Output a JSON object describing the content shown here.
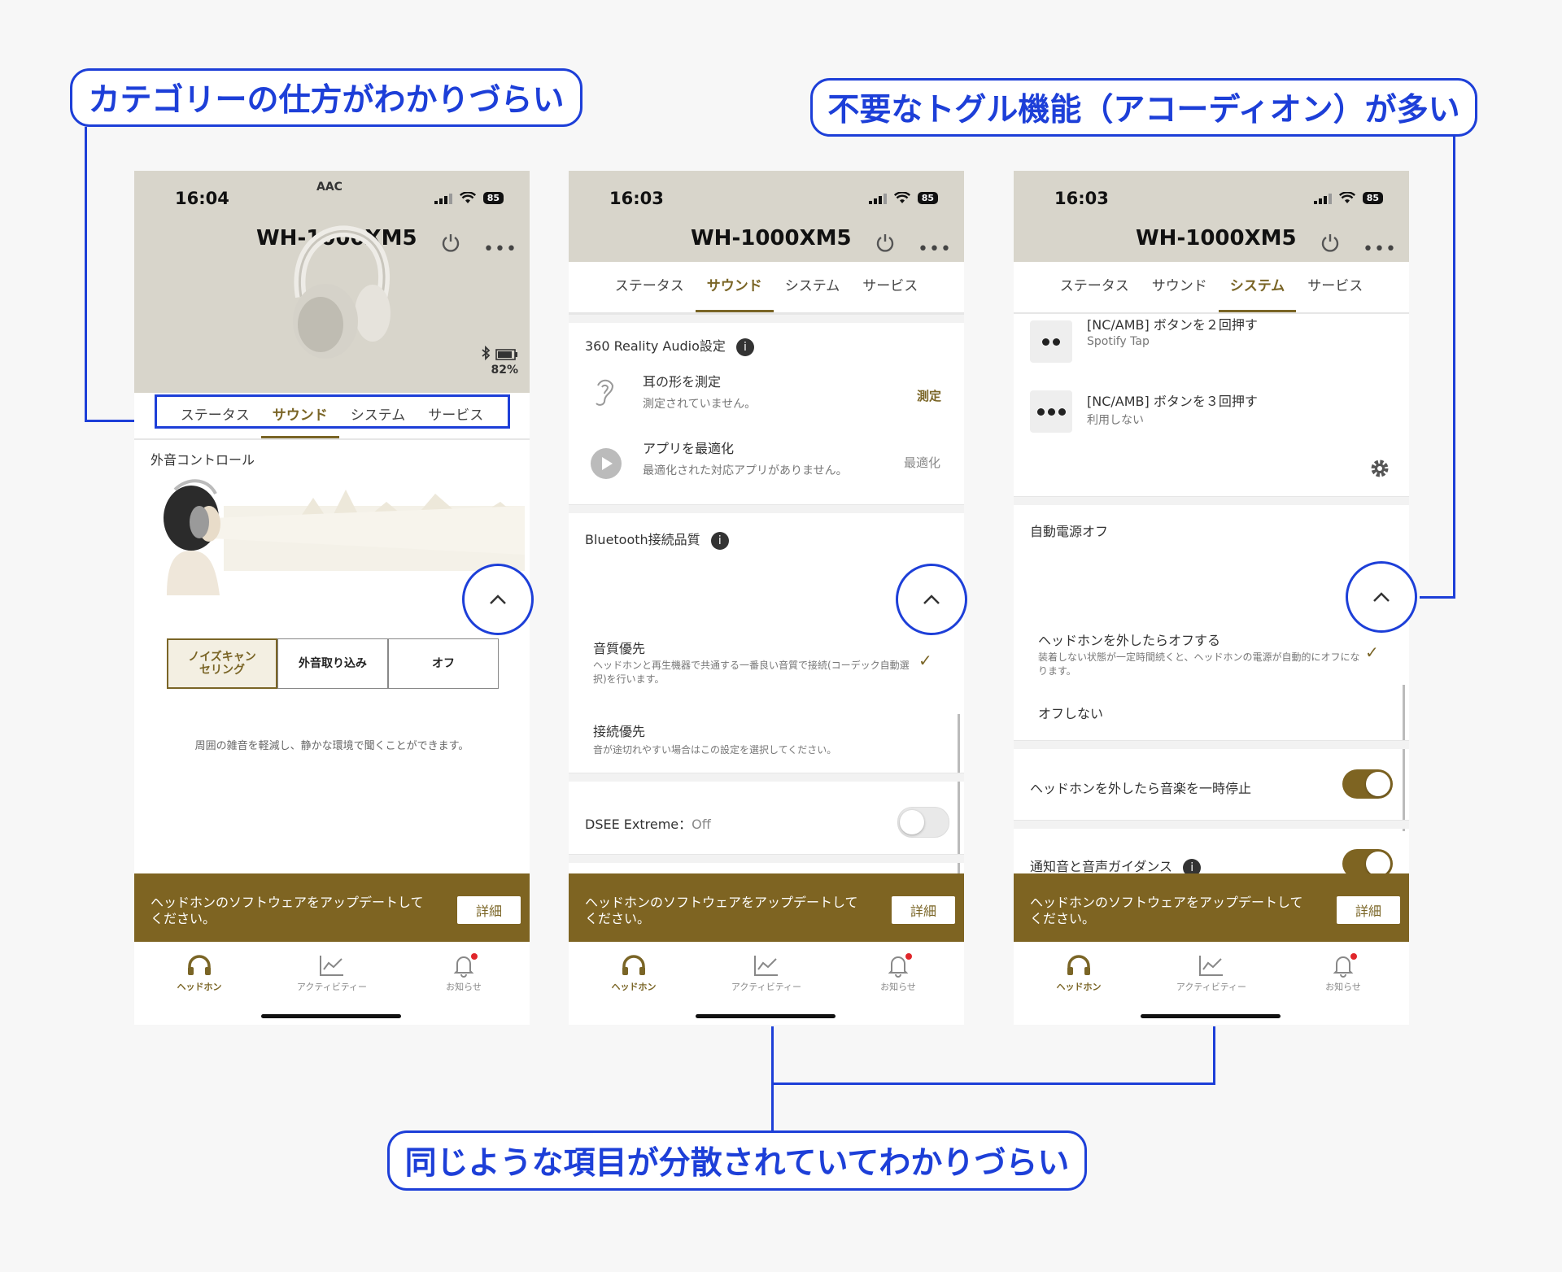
{
  "annotations": {
    "categories": "カテゴリーの仕方がわかりづらい",
    "toggles": "不要なトグル機能（アコーディオン）が多い",
    "scattered": "同じような項目が分散されていてわかりづらい"
  },
  "common": {
    "model": "WH-1000XM5",
    "tabs": [
      "ステータス",
      "サウンド",
      "システム",
      "サービス"
    ],
    "banner_text": "ヘッドホンのソフトウェアをアップデートしてください。",
    "banner_button": "詳細",
    "nav": [
      "ヘッドホン",
      "アクティビティー",
      "お知らせ"
    ],
    "battery_badge": "85",
    "accent_color": "#7a6526",
    "callout_color": "#1d3fd8"
  },
  "screen1": {
    "time": "16:04",
    "codec": "AAC",
    "battery_percent": "82%",
    "section_title": "外音コントロール",
    "modes": [
      "ノイズキャンセリング",
      "外音取り込み",
      "オフ"
    ],
    "mode_description": "周囲の雑音を軽減し、静かな環境で聞くことができます。"
  },
  "screen2": {
    "time": "16:03",
    "reality_title": "360 Reality Audio設定",
    "ear_title": "耳の形を測定",
    "ear_sub": "測定されていません。",
    "ear_action": "測定",
    "app_title": "アプリを最適化",
    "app_sub": "最適化された対応アプリがありません。",
    "app_action": "最適化",
    "bt_title": "Bluetooth接続品質",
    "quality_title": "音質優先",
    "quality_sub": "ヘッドホンと再生機器で共通する一番良い音質で接続(コーデック自動選択)を行います。",
    "connection_title": "接続優先",
    "connection_sub": "音が途切れやすい場合はこの設定を選択してください。",
    "dsee_label": "DSEE Extreme：",
    "dsee_value": "Off"
  },
  "screen3": {
    "time": "16:03",
    "double_title": "[NC/AMB] ボタンを２回押す",
    "double_sub": "Spotify Tap",
    "triple_title": "[NC/AMB] ボタンを３回押す",
    "triple_sub": "利用しない",
    "auto_off_title": "自動電源オフ",
    "auto_off_option_title": "ヘッドホンを外したらオフする",
    "auto_off_option_sub": "装着しない状態が一定時間続くと、ヘッドホンの電源が自動的にオフになります。",
    "no_off": "オフしない",
    "pause_label": "ヘッドホンを外したら音楽を一時停止",
    "guidance_label": "通知音と音声ガイダンス"
  }
}
